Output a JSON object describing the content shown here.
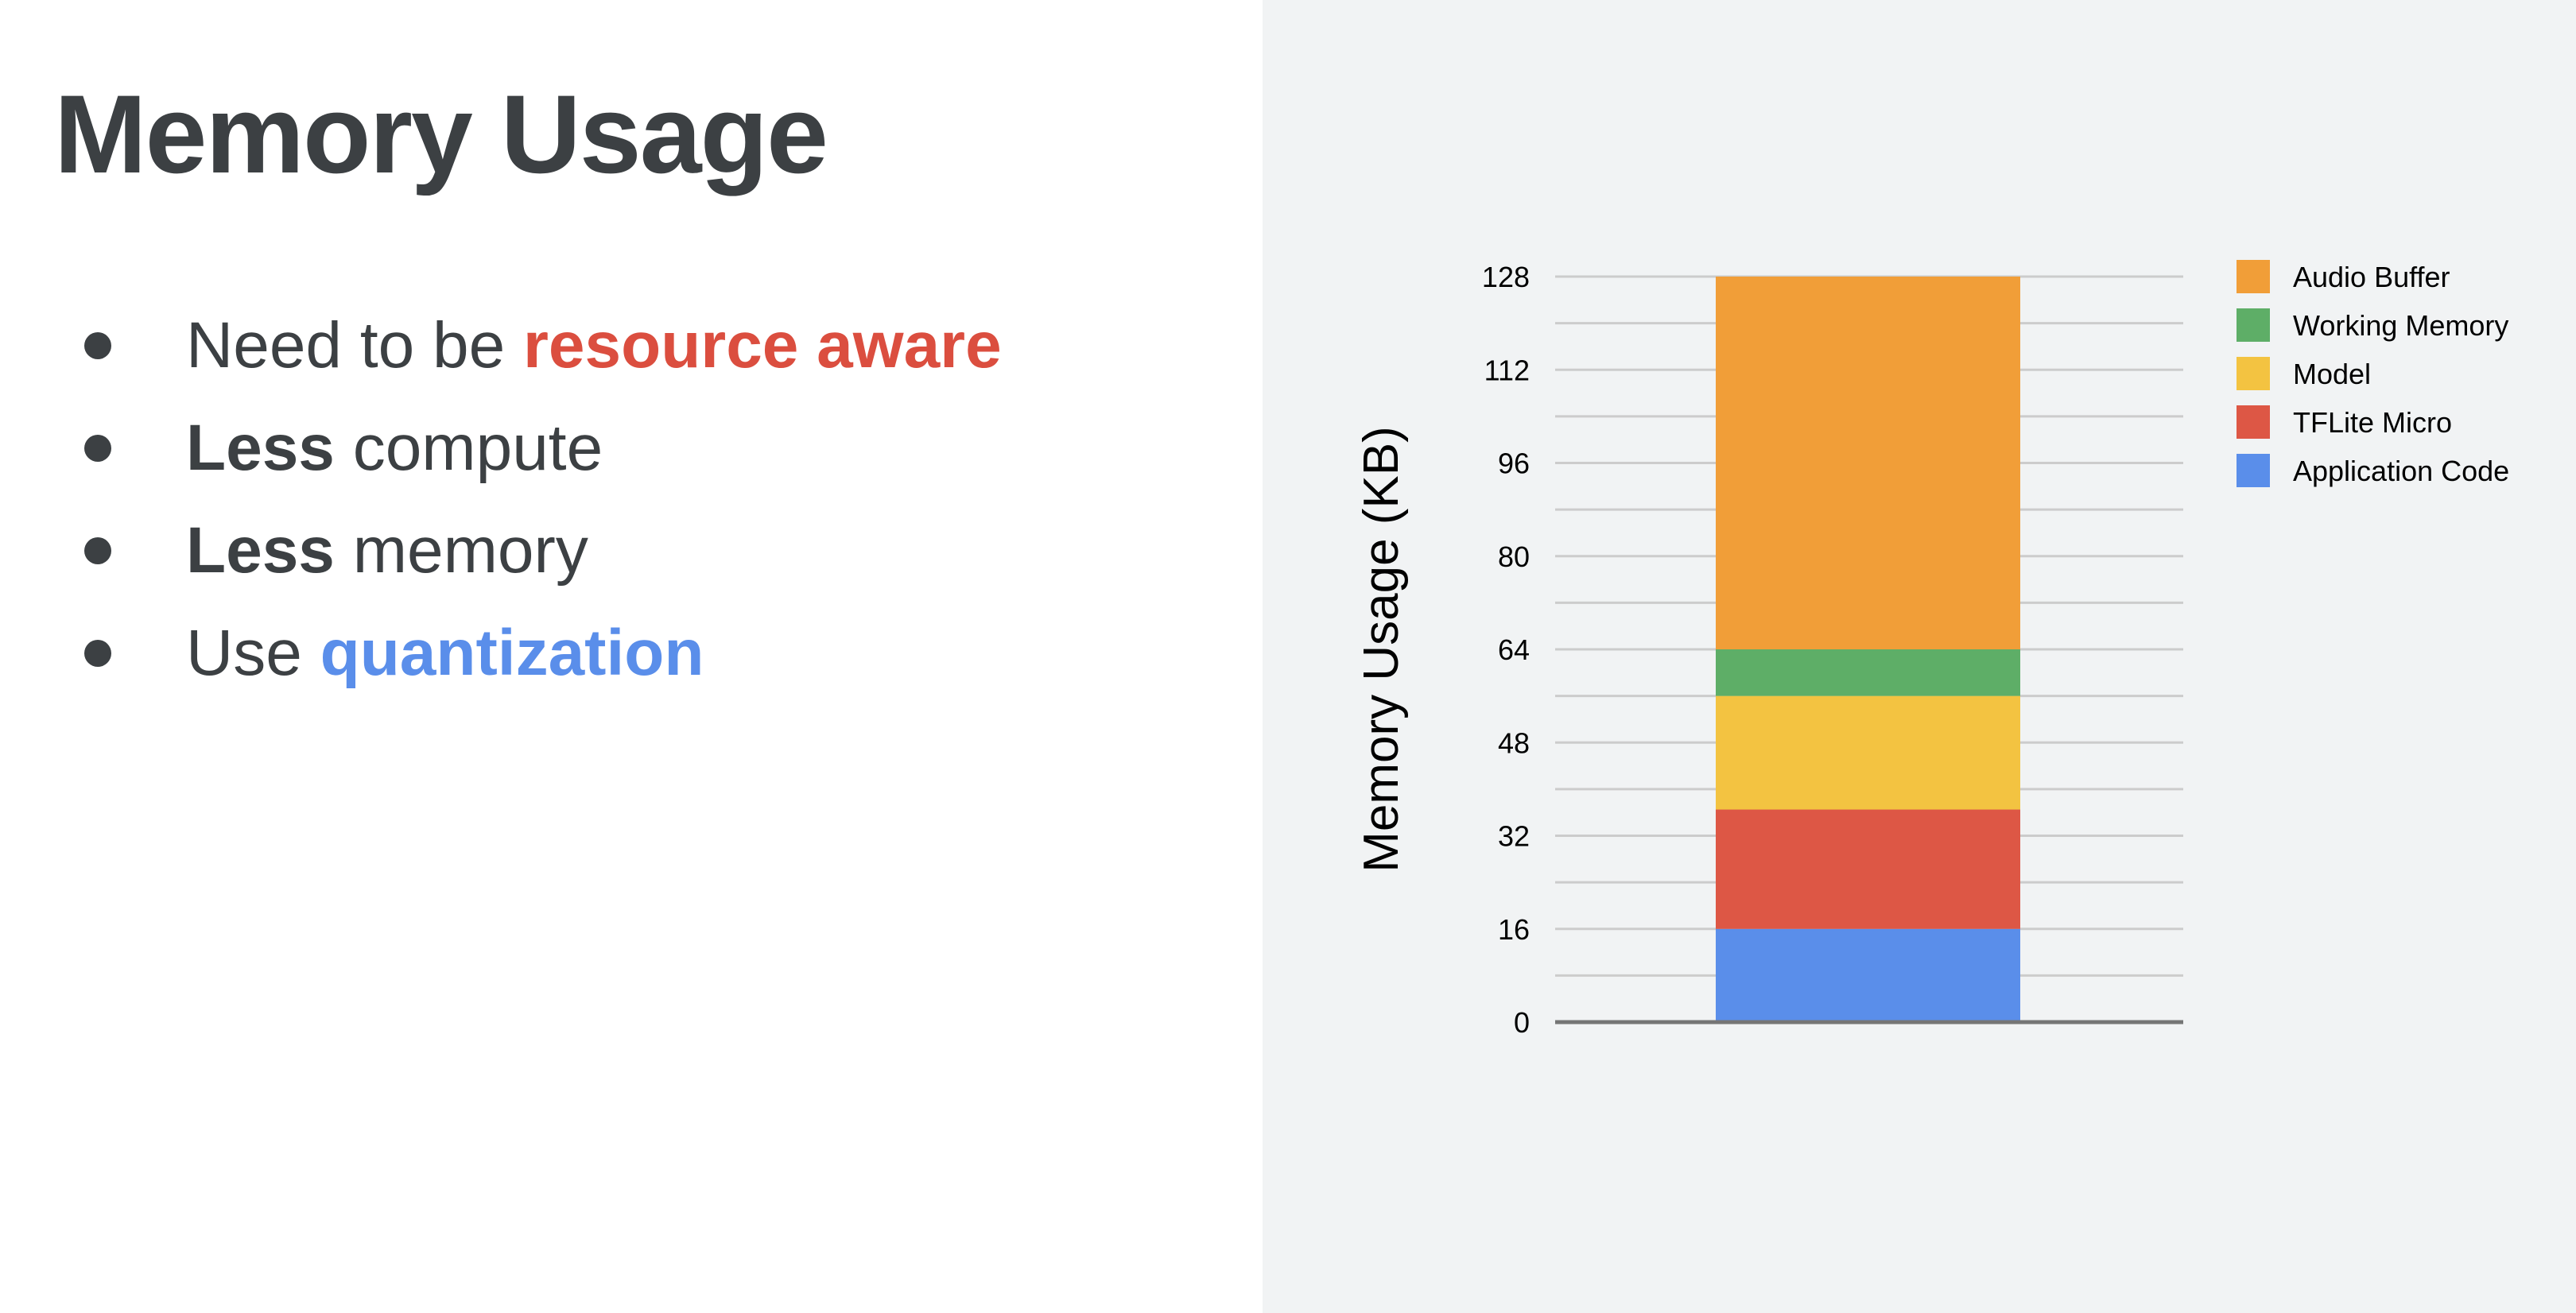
{
  "slide": {
    "title": "Memory Usage",
    "bullets": [
      {
        "parts": [
          {
            "text": "Need to be ",
            "style": "normal"
          },
          {
            "text": "resource aware",
            "style": "red"
          }
        ]
      },
      {
        "parts": [
          {
            "text": "Less",
            "style": "bold"
          },
          {
            "text": " compute",
            "style": "normal"
          }
        ]
      },
      {
        "parts": [
          {
            "text": "Less",
            "style": "bold"
          },
          {
            "text": " memory",
            "style": "normal"
          }
        ]
      },
      {
        "parts": [
          {
            "text": "Use ",
            "style": "normal"
          },
          {
            "text": "quantization",
            "style": "blue"
          }
        ]
      }
    ]
  },
  "colors": {
    "title_text": "#3c4043",
    "accent_red": "#db4e3f",
    "accent_blue": "#5a8eea",
    "chart_panel_bg": "#f1f3f4"
  },
  "chart_data": {
    "type": "bar",
    "stacked": true,
    "categories": [
      ""
    ],
    "series": [
      {
        "name": "Application Code",
        "values": [
          16
        ],
        "color": "#5a8eea"
      },
      {
        "name": "TFLite Micro",
        "values": [
          20.5
        ],
        "color": "#dd5745"
      },
      {
        "name": "Model",
        "values": [
          19.5
        ],
        "color": "#f3c341"
      },
      {
        "name": "Working Memory",
        "values": [
          8
        ],
        "color": "#5eae67"
      },
      {
        "name": "Audio Buffer",
        "values": [
          64
        ],
        "color": "#f19e38"
      }
    ],
    "legend_order": [
      "Audio Buffer",
      "Working Memory",
      "Model",
      "TFLite Micro",
      "Application Code"
    ],
    "ylabel": "Memory Usage (KB)",
    "xlabel": "",
    "title": "",
    "ylim": [
      0,
      128
    ],
    "yticks": [
      0,
      16,
      32,
      48,
      64,
      80,
      96,
      112,
      128
    ],
    "grid": true,
    "legend_position": "right"
  }
}
